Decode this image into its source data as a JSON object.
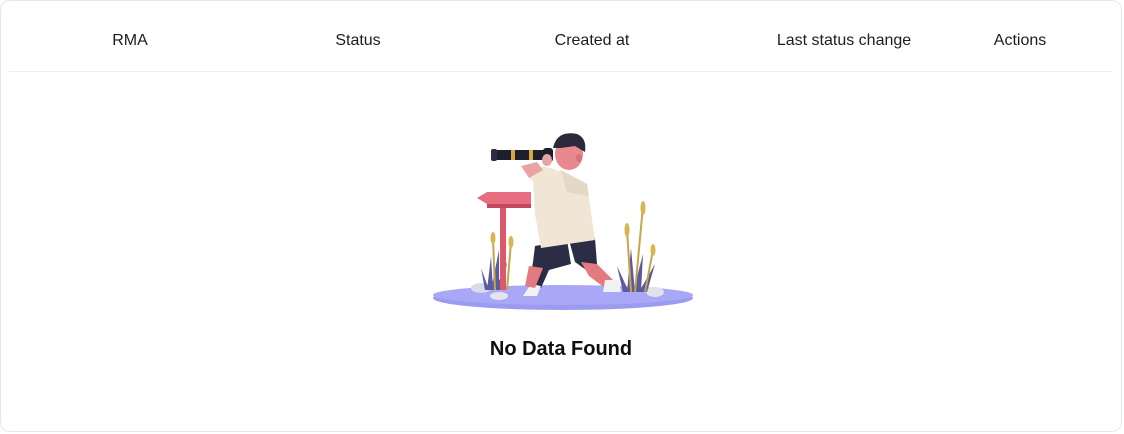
{
  "table": {
    "columns": [
      "RMA",
      "Status",
      "Created at",
      "Last status change",
      "Actions"
    ]
  },
  "empty_state": {
    "message": "No Data Found",
    "illustration": "person-with-telescope-illustration"
  },
  "colors": {
    "border": "#e6e8ec",
    "text": "#1b1d21",
    "ground": "#9b9bf0",
    "sign": "#e0566e"
  }
}
